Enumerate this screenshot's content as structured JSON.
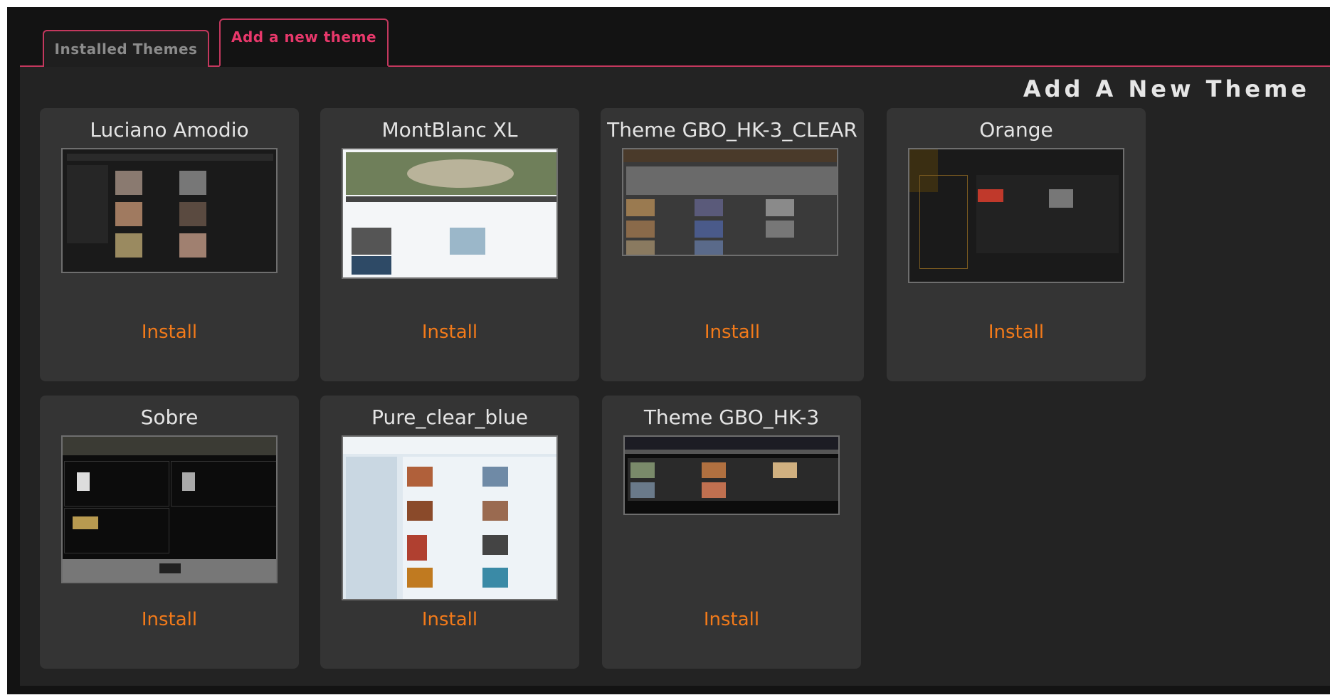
{
  "tabs": [
    {
      "label": "Installed Themes",
      "active": false
    },
    {
      "label": "Add a new theme",
      "active": true
    }
  ],
  "heading": "Add A New Theme",
  "themes": [
    {
      "name": "Luciano Amodio",
      "action": "Install"
    },
    {
      "name": "MontBlanc XL",
      "action": "Install"
    },
    {
      "name": "Theme GBO_HK-3_CLEAR",
      "action": "Install"
    },
    {
      "name": "Orange",
      "action": "Install"
    },
    {
      "name": "Sobre",
      "action": "Install"
    },
    {
      "name": "Pure_clear_blue",
      "action": "Install"
    },
    {
      "name": "Theme GBO_HK-3",
      "action": "Install"
    }
  ],
  "colors": {
    "accent": "#e8386b",
    "install": "#f27a1a",
    "card_bg": "#343434",
    "page_bg": "#232323"
  }
}
